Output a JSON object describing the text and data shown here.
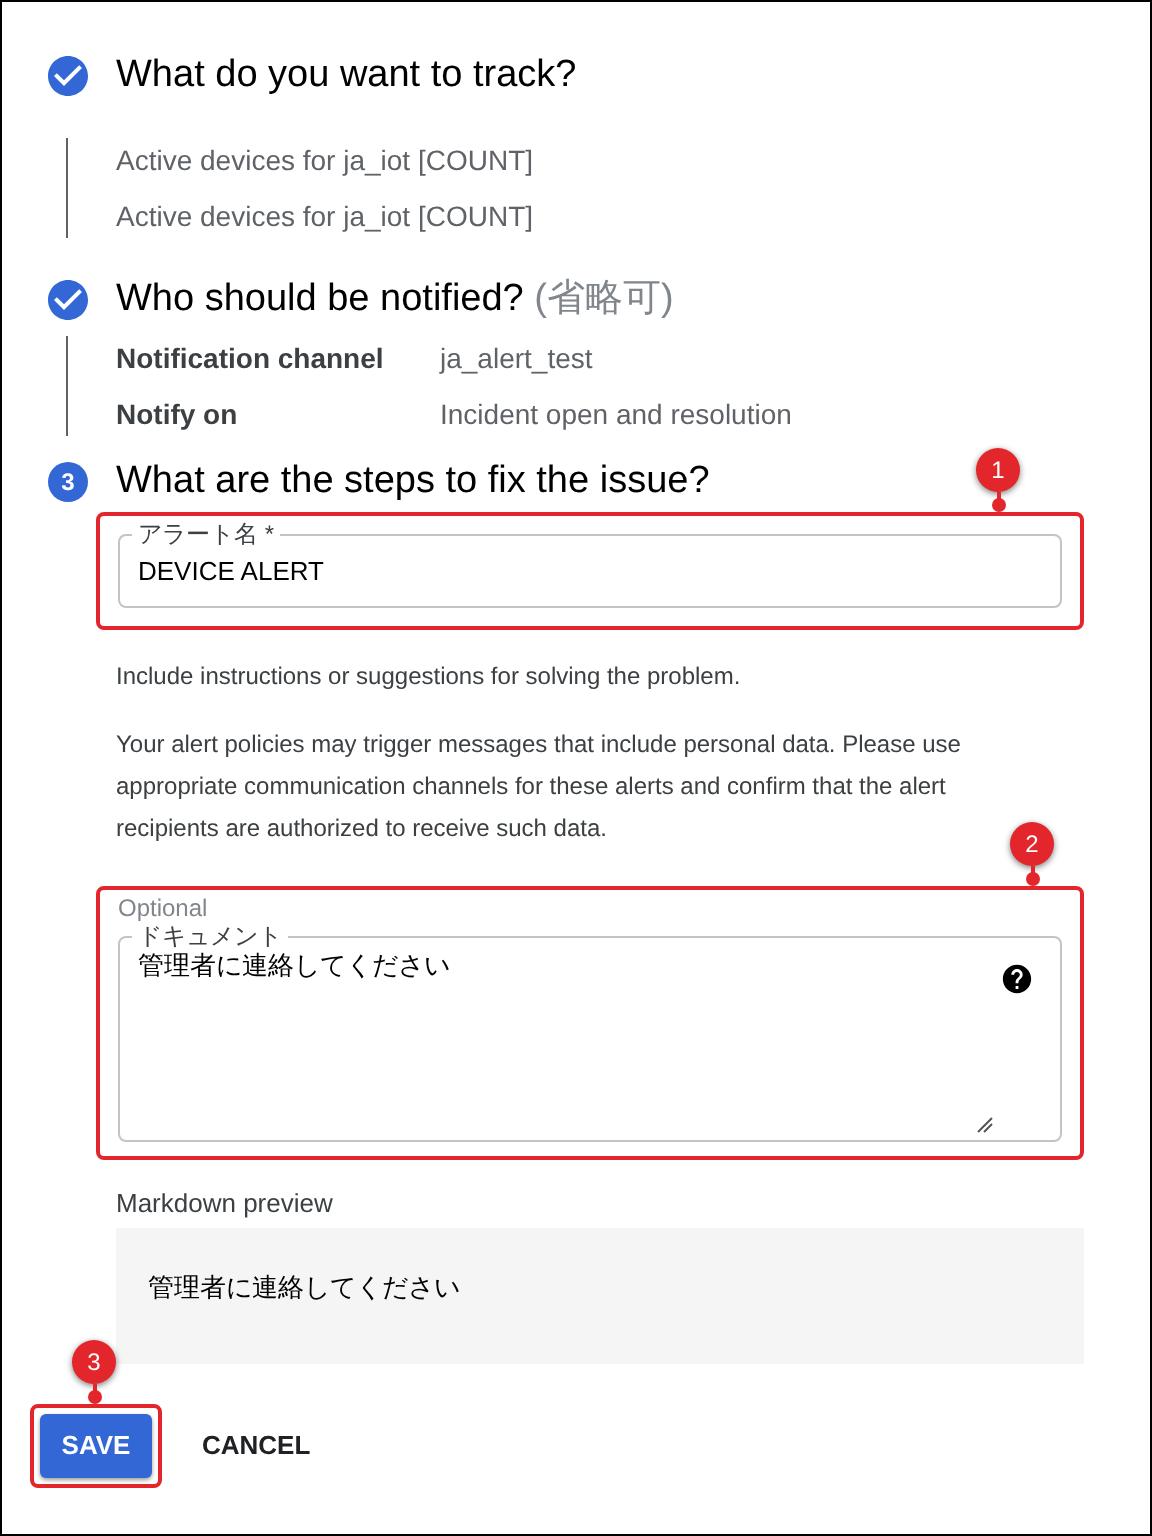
{
  "steps": [
    {
      "kind": "done",
      "title": "What do you want to track?",
      "items": [
        "Active devices for ja_iot [COUNT]",
        "Active devices for ja_iot [COUNT]"
      ]
    },
    {
      "kind": "done",
      "title": "Who should be notified?",
      "title_note": "(省略可)",
      "rows": [
        {
          "label": "Notification channel",
          "value": "ja_alert_test"
        },
        {
          "label": "Notify on",
          "value": "Incident open and resolution"
        }
      ]
    },
    {
      "kind": "number",
      "number": "3",
      "title": "What are the steps to fix the issue?"
    }
  ],
  "alert_name_field": {
    "label": "アラート名 *",
    "value": "DEVICE ALERT",
    "callout": "1"
  },
  "help_text": "Include instructions or suggestions for solving the problem.",
  "privacy_note": "Your alert policies may trigger messages that include personal data. Please use appropriate communication channels for these alerts and confirm that the alert recipients are authorized to receive such data.",
  "documentation_field": {
    "hint": "Optional",
    "label": "ドキュメント",
    "value": "管理者に連絡してください",
    "callout": "2"
  },
  "markdown_preview": {
    "label": "Markdown preview",
    "content": "管理者に連絡してください"
  },
  "buttons": [
    {
      "kind": "primary",
      "label": "SAVE",
      "callout": "3"
    },
    {
      "kind": "text",
      "label": "CANCEL"
    }
  ]
}
